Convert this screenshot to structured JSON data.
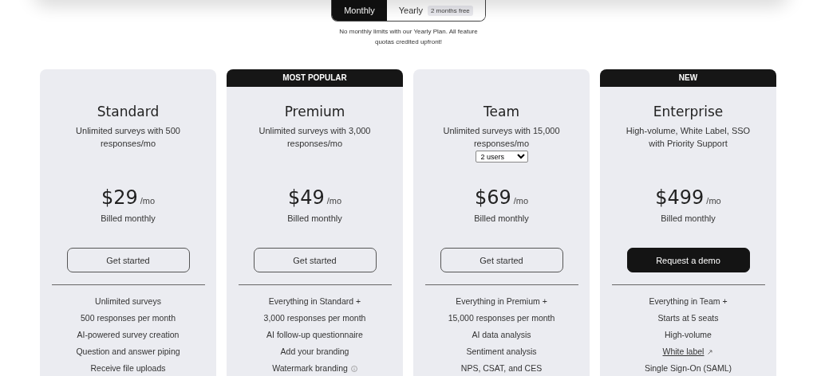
{
  "billing_toggle": {
    "tabs": [
      {
        "label": "Monthly",
        "selected": true
      },
      {
        "label": "Yearly",
        "selected": false,
        "badge": "2 months free"
      }
    ]
  },
  "note": "No monthly limits with our Yearly Plan. All feature quotas credited upfront!",
  "plans": [
    {
      "name": "Standard",
      "description": "Unlimited surveys with 500 responses/mo",
      "price": "$29",
      "period": "/mo",
      "billing": "Billed monthly",
      "button": {
        "label": "Get started",
        "kind": "outline"
      },
      "features": [
        {
          "text": "Unlimited surveys",
          "kind": "plain"
        },
        {
          "text": "500 responses per month",
          "kind": "plain"
        },
        {
          "text": "AI-powered survey creation",
          "kind": "plain"
        },
        {
          "text": "Question and answer piping",
          "kind": "plain"
        },
        {
          "text": "Receive file uploads",
          "kind": "plain"
        }
      ]
    },
    {
      "name": "Premium",
      "badge": "MOST POPULAR",
      "description": "Unlimited surveys with 3,000 responses/mo",
      "price": "$49",
      "period": "/mo",
      "billing": "Billed monthly",
      "button": {
        "label": "Get started",
        "kind": "outline"
      },
      "features": [
        {
          "text": "Everything in Standard +",
          "kind": "plain"
        },
        {
          "text": "3,000 responses per month",
          "kind": "plain"
        },
        {
          "text": "AI follow-up questionnaire",
          "kind": "plain"
        },
        {
          "text": "Add your branding",
          "kind": "plain"
        },
        {
          "text": "Watermark branding",
          "kind": "info"
        }
      ]
    },
    {
      "name": "Team",
      "description": "Unlimited surveys with 15,000 responses/mo",
      "seats": "2 users",
      "price": "$69",
      "period": "/mo",
      "billing": "Billed monthly",
      "button": {
        "label": "Get started",
        "kind": "outline"
      },
      "features": [
        {
          "text": "Everything in Premium +",
          "kind": "plain"
        },
        {
          "text": "15,000 responses per month",
          "kind": "plain"
        },
        {
          "text": "AI data analysis",
          "kind": "plain"
        },
        {
          "text": "Sentiment analysis",
          "kind": "plain"
        },
        {
          "text": "NPS, CSAT, and CES",
          "kind": "plain"
        }
      ]
    },
    {
      "name": "Enterprise",
      "badge": "NEW",
      "description": "High-volume, White Label, SSO with Priority Support",
      "price": "$499",
      "period": "/mo",
      "billing": "Billed monthly",
      "button": {
        "label": "Request a demo",
        "kind": "filled"
      },
      "features": [
        {
          "text": "Everything in Team +",
          "kind": "plain"
        },
        {
          "text": "Starts at 5 seats",
          "kind": "plain"
        },
        {
          "text": "High-volume",
          "kind": "plain"
        },
        {
          "text": "White label",
          "kind": "link"
        },
        {
          "text": "Single Sign-On (SAML)",
          "kind": "plain"
        }
      ]
    }
  ]
}
